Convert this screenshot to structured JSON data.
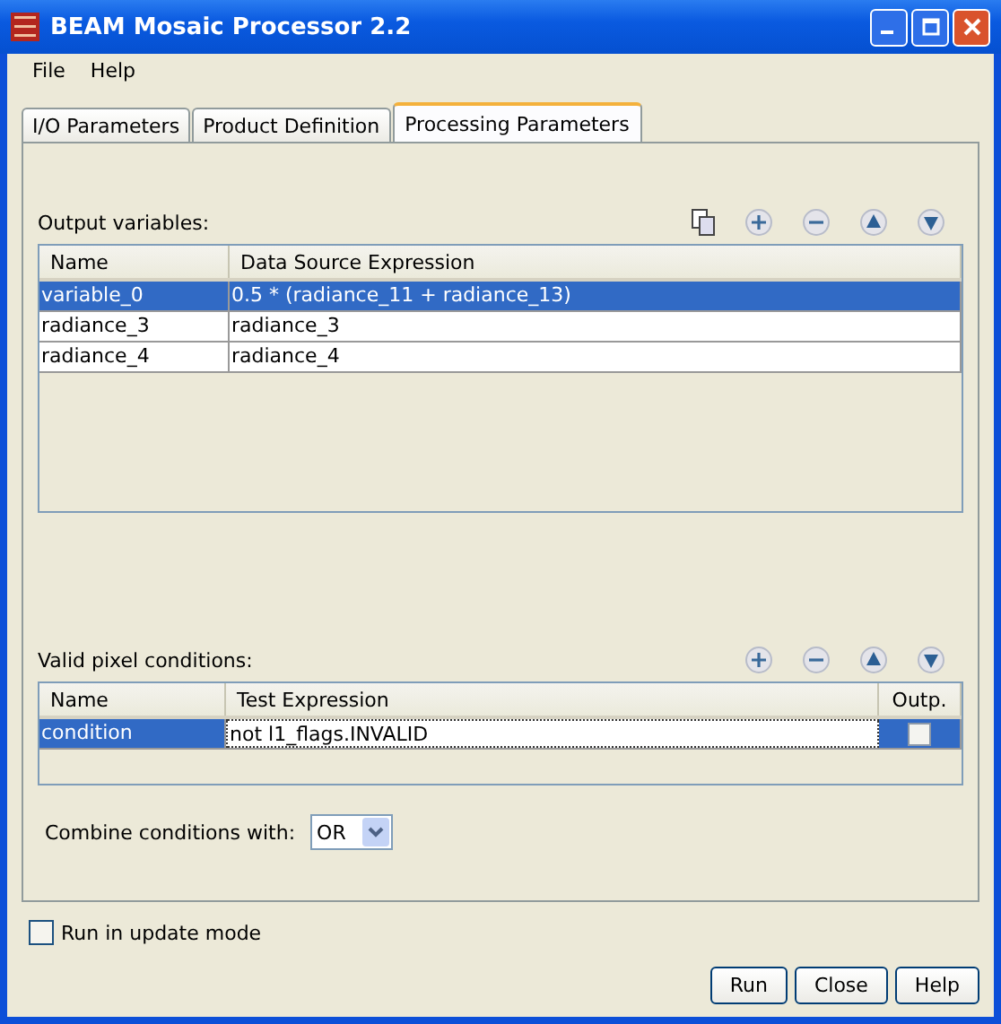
{
  "window": {
    "title": "BEAM Mosaic Processor 2.2"
  },
  "menu": [
    "File",
    "Help"
  ],
  "tabs": [
    {
      "label": "I/O Parameters",
      "selected": false
    },
    {
      "label": "Product Definition",
      "selected": false
    },
    {
      "label": "Processing Parameters",
      "selected": true
    }
  ],
  "output_variables": {
    "label": "Output variables:",
    "columns": [
      "Name",
      "Data Source Expression"
    ],
    "rows": [
      {
        "cells": [
          "variable_0",
          "0.5 * (radiance_11 + radiance_13)"
        ],
        "selected": true
      },
      {
        "cells": [
          "radiance_3",
          "radiance_3"
        ],
        "selected": false
      },
      {
        "cells": [
          "radiance_4",
          "radiance_4"
        ],
        "selected": false
      }
    ]
  },
  "valid_pixel_conditions": {
    "label": "Valid pixel conditions:",
    "columns": [
      "Name",
      "Test Expression",
      "Outp."
    ],
    "rows": [
      {
        "cells": [
          "condition",
          "not l1_flags.INVALID"
        ],
        "output": false,
        "selected": true
      }
    ]
  },
  "combine": {
    "label": "Combine conditions with:",
    "value": "OR"
  },
  "update_mode": {
    "label": "Run in update mode",
    "checked": false
  },
  "buttons": [
    "Run",
    "Close",
    "Help"
  ]
}
